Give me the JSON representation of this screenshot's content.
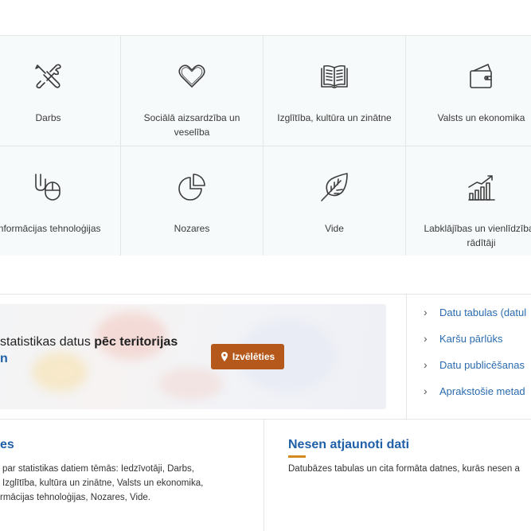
{
  "categories": [
    {
      "label": "Darbs",
      "icon": "tools-icon"
    },
    {
      "label": "Sociālā aizsardzība un veselība",
      "icon": "heart-icon"
    },
    {
      "label": "Izglītība, kultūra un zinātne",
      "icon": "book-icon"
    },
    {
      "label": "Valsts un ekonomika",
      "icon": "wallet-icon"
    },
    {
      "label": "Informācijas tehnoloģijas",
      "icon": "mouse-cable-icon"
    },
    {
      "label": "Nozares",
      "icon": "pie-chart-icon"
    },
    {
      "label": "Vide",
      "icon": "leaf-icon"
    },
    {
      "label": "Labklājības un vienlīdzības rādītāji",
      "icon": "bar-chart-growth-icon"
    }
  ],
  "territory": {
    "text_prefix": "statistikas datus ",
    "text_bold": "pēc teritorijas",
    "text_line2": "n",
    "button_label": "Izvēlēties"
  },
  "quick_links": [
    "Datu tabulas (datul",
    "Karšu pārlūks",
    "Datu publicēšanas",
    "Aprakstošie metad"
  ],
  "left_column": {
    "title": "es",
    "lines": [
      "par statistikas datiem tēmās: Iedzīvotāji, Darbs,",
      "Izglītība, kultūra un zinātne, Valsts un ekonomika,",
      "rmācijas tehnoloģijas, Nozares, Vide."
    ]
  },
  "right_column": {
    "title": "Nesen atjaunoti dati",
    "text": "Datubāzes tabulas un cita formāta datnes, kurās nesen a"
  },
  "colors": {
    "accent_button": "#b4581b",
    "link": "#2b6cb0",
    "title": "#1f5fa8",
    "underline": "#d08a1e"
  }
}
